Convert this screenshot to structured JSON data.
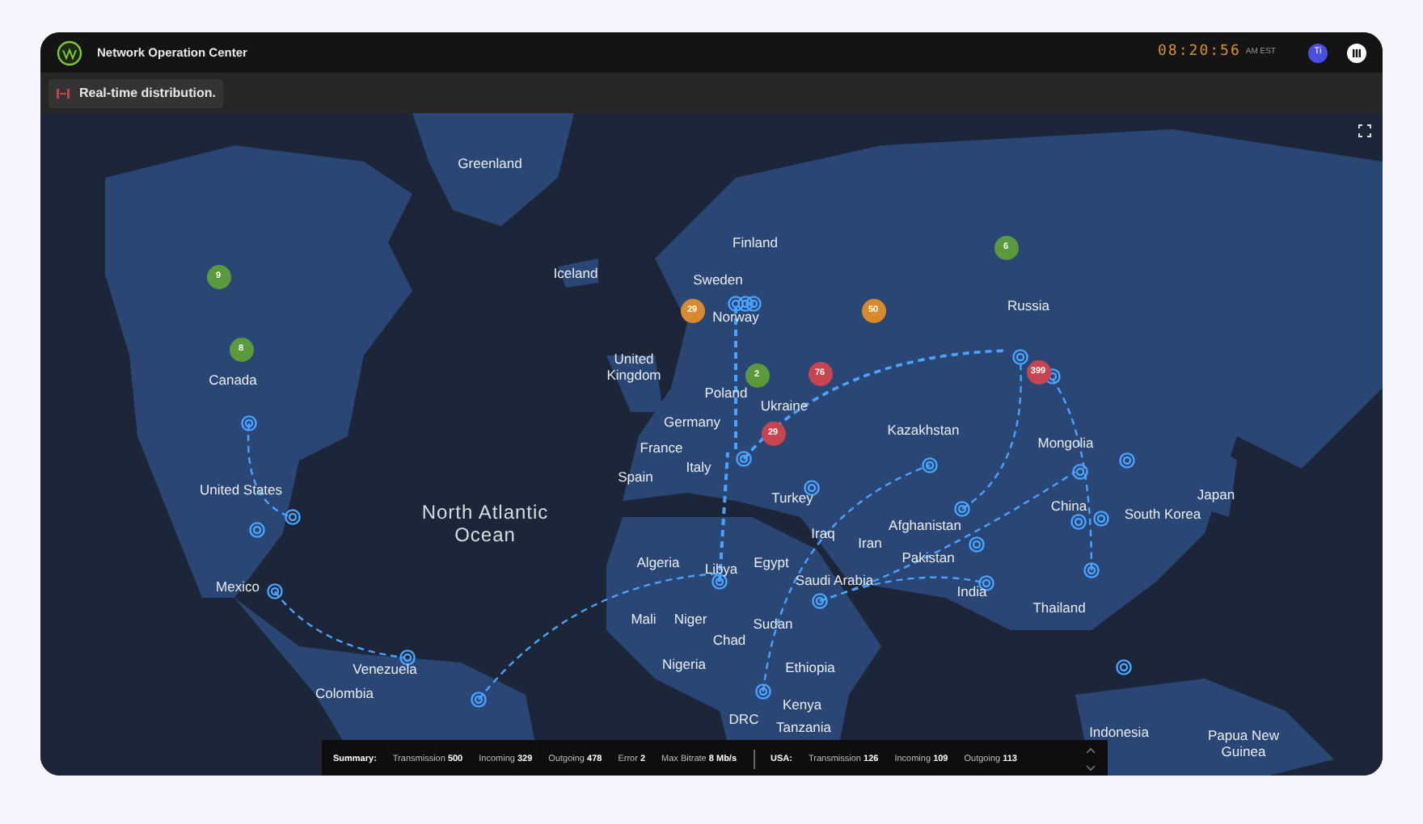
{
  "header": {
    "title": "Network Operation Center",
    "clock": {
      "time": "08:20:56",
      "zone": "AM EST"
    },
    "avatar": "Ti"
  },
  "toolbar": {
    "label": "Real-time distribution."
  },
  "map": {
    "ocean_label": "North Atlantic Ocean",
    "labels": [
      "Greenland",
      "Finland",
      "Iceland",
      "Sweden",
      "Russia",
      "Norway",
      "Canada",
      "United Kingdom",
      "Poland",
      "Germany",
      "Ukraine",
      "Kazakhstan",
      "France",
      "Mongolia",
      "Spain",
      "Italy",
      "United States",
      "Turkey",
      "Japan",
      "China",
      "Afghanistan",
      "South Korea",
      "Iraq",
      "Iran",
      "Pakistan",
      "Algeria",
      "Libya",
      "Egypt",
      "Mexico",
      "Saudi Arabia",
      "India",
      "Thailand",
      "Mali",
      "Niger",
      "Sudan",
      "Chad",
      "Venezuela",
      "Nigeria",
      "Ethiopia",
      "Colombia",
      "DRC",
      "Kenya",
      "Tanzania",
      "Indonesia",
      "Papua New Guinea"
    ],
    "clusters": [
      {
        "count": "6",
        "color": "#5a9a3c"
      },
      {
        "count": "9",
        "color": "#5a9a3c"
      },
      {
        "count": "29",
        "color": "#d88a2c"
      },
      {
        "count": "50",
        "color": "#d88a2c"
      },
      {
        "count": "8",
        "color": "#5a9a3c"
      },
      {
        "count": "2",
        "color": "#5a9a3c"
      },
      {
        "count": "76",
        "color": "#c8454f"
      },
      {
        "count": "399",
        "color": "#c8454f"
      },
      {
        "count": "29",
        "color": "#c8454f"
      }
    ]
  },
  "summary": {
    "label": "Summary:",
    "items": [
      {
        "label": "Transmission",
        "value": "500"
      },
      {
        "label": "Incoming",
        "value": "329"
      },
      {
        "label": "Outgoing",
        "value": "478"
      },
      {
        "label": "Error",
        "value": "2"
      },
      {
        "label": "Max Bitrate",
        "value": "8 Mb/s"
      }
    ],
    "region": "USA:",
    "region_items": [
      {
        "label": "Transmission",
        "value": "126"
      },
      {
        "label": "Incoming",
        "value": "109"
      },
      {
        "label": "Outgoing",
        "value": "113"
      }
    ]
  }
}
